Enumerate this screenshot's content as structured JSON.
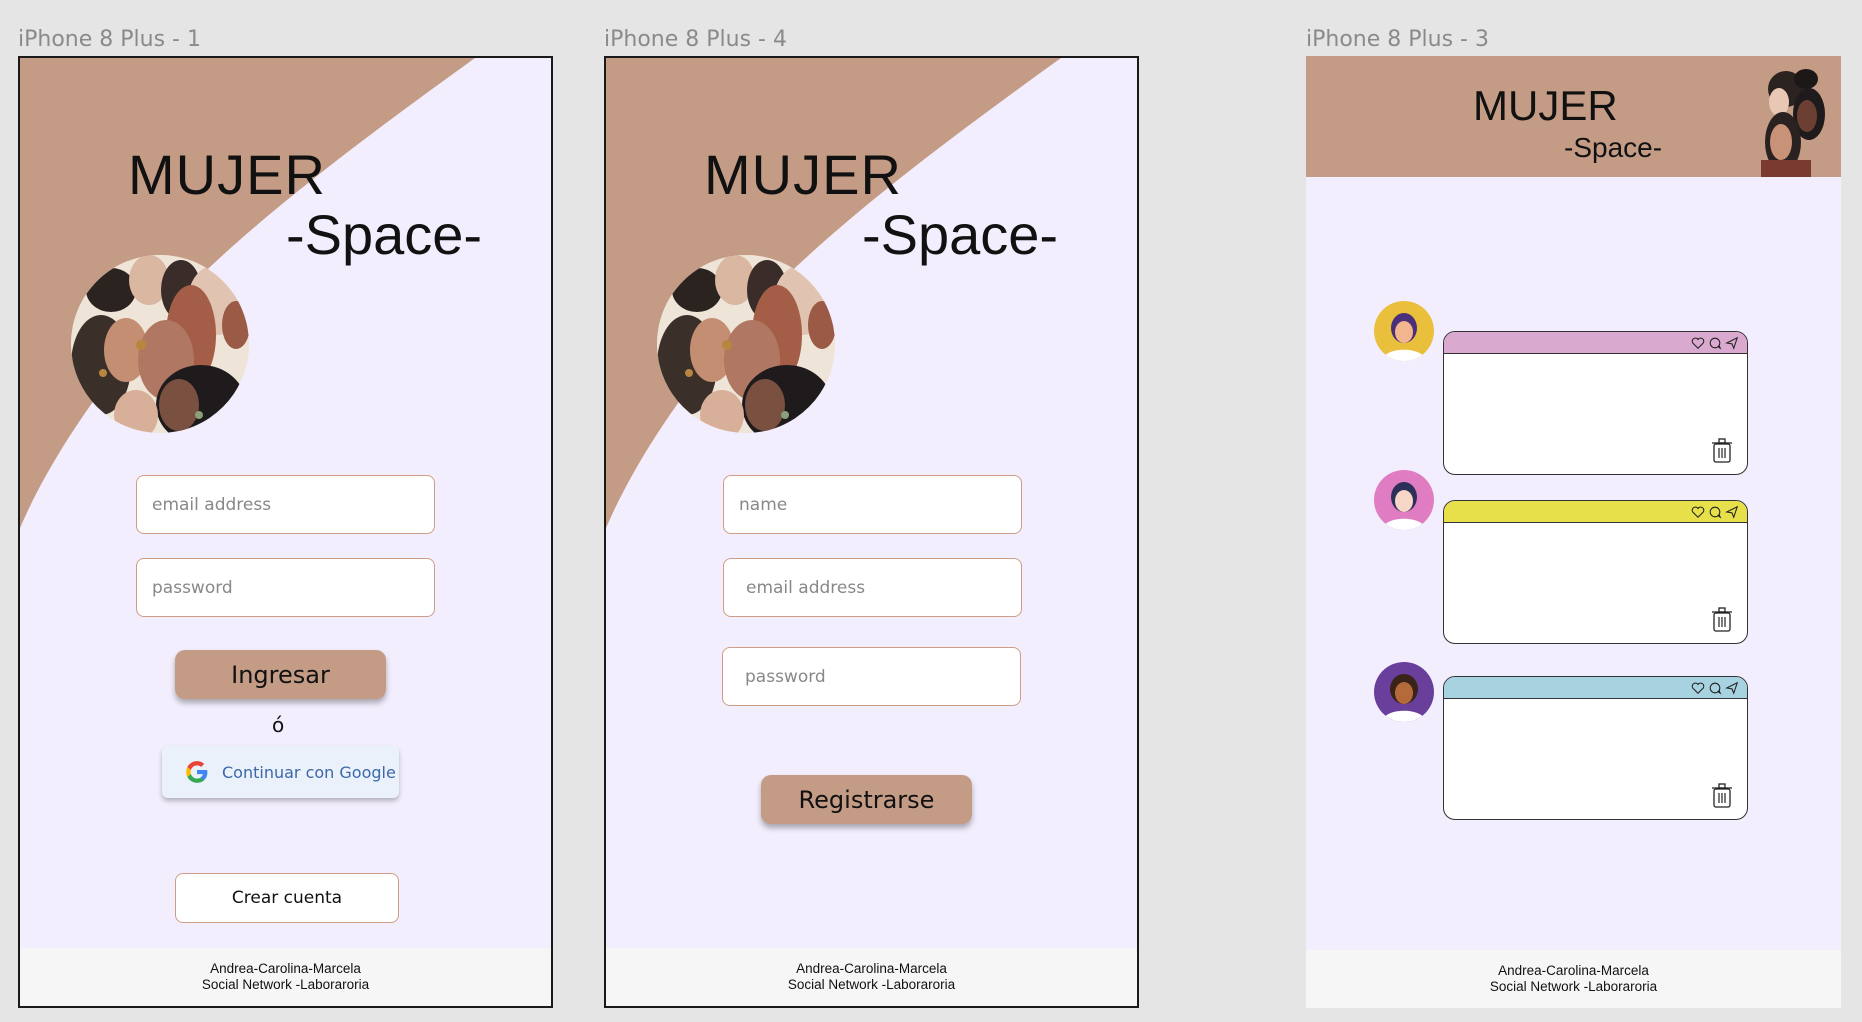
{
  "frames": [
    {
      "label": "iPhone 8 Plus - 1"
    },
    {
      "label": "iPhone 8 Plus - 4"
    },
    {
      "label": "iPhone 8 Plus - 3"
    }
  ],
  "brand": {
    "title": "MUJER",
    "subtitle": "-Space-"
  },
  "login": {
    "email_placeholder": "email address",
    "password_placeholder": "password",
    "login_button": "Ingresar",
    "or_text": "ó",
    "google_button": "Continuar con Google",
    "create_account_button": "Crear cuenta"
  },
  "register": {
    "name_placeholder": "name",
    "email_placeholder": "email address",
    "password_placeholder": "password",
    "register_button": "Registrarse"
  },
  "footer": {
    "line1": "Andrea-Carolina-Marcela",
    "line2": "Social Network -Laboraroria"
  },
  "feed": {
    "posts": [
      {
        "bar_color": "#d9a9cf",
        "avatar_color": "#e9bf3c",
        "icons": [
          "heart-icon",
          "comment-icon",
          "send-icon"
        ]
      },
      {
        "bar_color": "#e8e04a",
        "avatar_color": "#e07cc2",
        "icons": [
          "heart-icon",
          "comment-icon",
          "send-icon"
        ]
      },
      {
        "bar_color": "#a7d2e0",
        "avatar_color": "#6a3f9c",
        "icons": [
          "heart-icon",
          "comment-icon",
          "send-icon"
        ]
      }
    ]
  },
  "colors": {
    "accent": "#c49c86",
    "background": "#f2eefd",
    "field_border": "#cf9d86",
    "google_text": "#3c67a8"
  }
}
